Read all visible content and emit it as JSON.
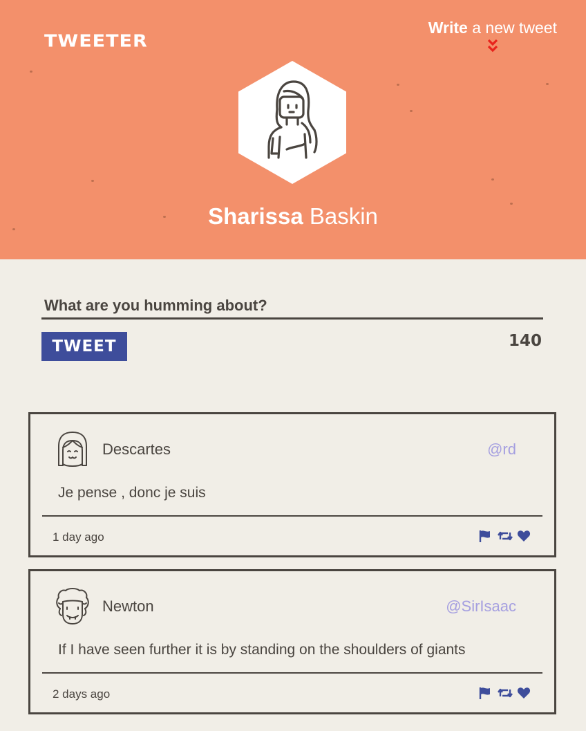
{
  "header": {
    "logo": "TWEETER",
    "compose_toggle": {
      "bold": "Write",
      "rest": " a new tweet"
    },
    "user": {
      "first_name": "Sharissa",
      "last_name": " Baskin"
    }
  },
  "compose": {
    "placeholder": "What are you humming about?",
    "button_label": "TWEET",
    "char_count": "140"
  },
  "tweets": [
    {
      "name": "Descartes",
      "handle": "@rd",
      "text": "Je pense , donc je suis",
      "time": "1 day ago"
    },
    {
      "name": "Newton",
      "handle": "@SirIsaac",
      "text": "If I have seen further it is by standing on the shoulders of giants",
      "time": "2 days ago"
    }
  ],
  "icons": [
    "chevron-double-down-icon",
    "flag-icon",
    "retweet-icon",
    "heart-icon"
  ],
  "colors": {
    "header_bg": "#f3906b",
    "page_bg": "#f1eee7",
    "accent_blue": "#3e4d9b",
    "handle": "#a59fe0",
    "text": "#4a4540",
    "chevron": "#e8231c"
  }
}
